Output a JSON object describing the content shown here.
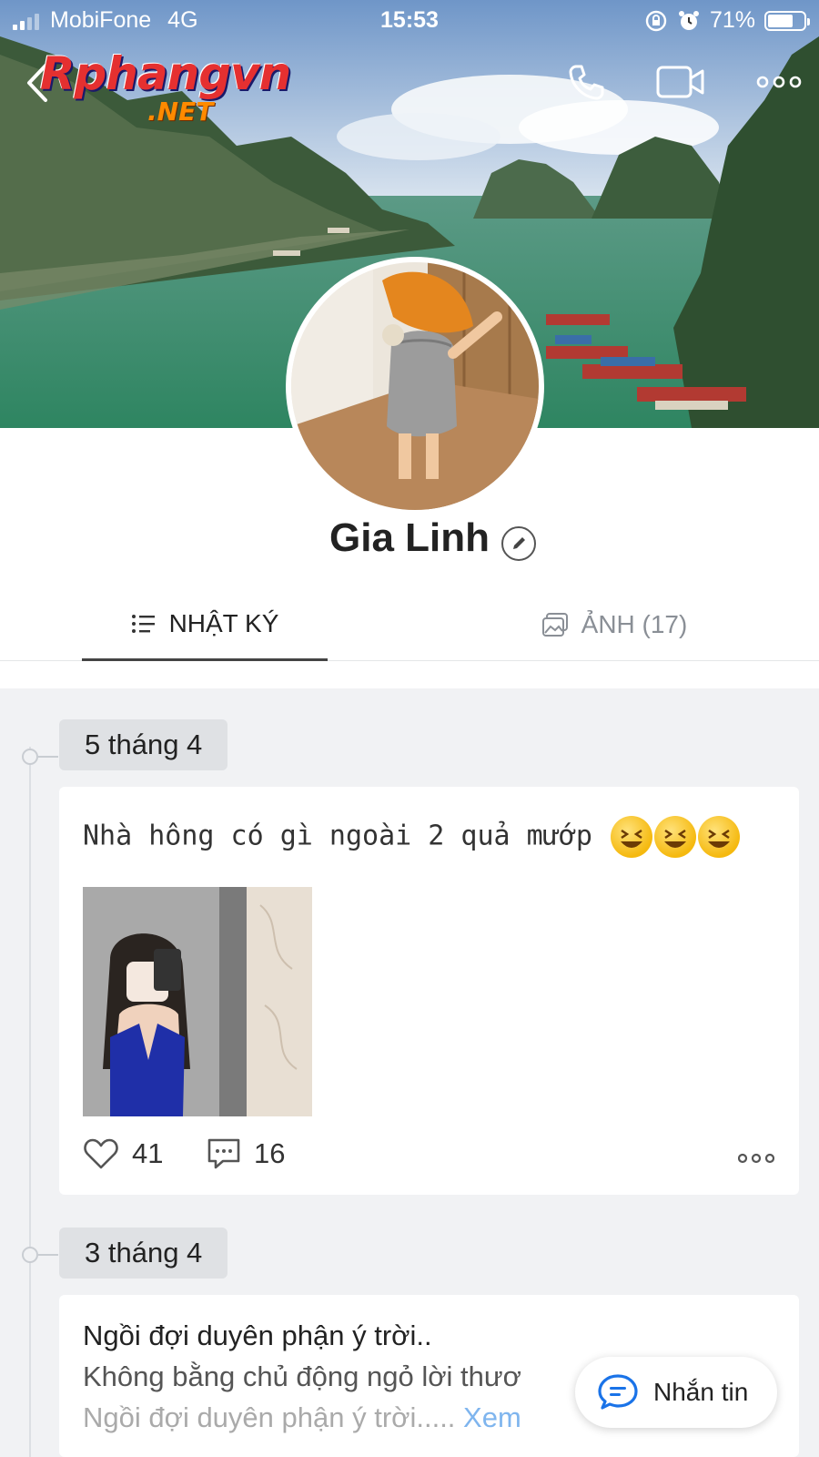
{
  "status_bar": {
    "carrier": "MobiFone",
    "network": "4G",
    "time": "15:53",
    "battery": "71%",
    "battery_level": 0.71,
    "signal_bars_active": 2,
    "signal_bars_total": 4
  },
  "watermark": {
    "main": "Rphangvn",
    "sub": ".NET"
  },
  "header": {
    "back_icon": "chevron-left-icon",
    "call_icon": "phone-icon",
    "video_icon": "video-camera-icon",
    "more_icon": "more-horizontal-icon"
  },
  "profile": {
    "name": "Gia Linh",
    "edit_icon": "pencil-icon"
  },
  "tabs": [
    {
      "label": "NHẬT KÝ",
      "icon": "list-icon",
      "active": true
    },
    {
      "label": "ẢNH (17)",
      "icon": "gallery-icon",
      "active": false
    }
  ],
  "feed": {
    "posts": [
      {
        "date": "5 tháng 4",
        "text": "Nhà hông có gì ngoài 2 quả mướp",
        "emoji_count": 3,
        "likes": "41",
        "comments": "16"
      },
      {
        "date": "3 tháng 4",
        "line1": "Ngồi đợi duyên phận ý trời..",
        "line2": "Không bằng chủ động ngỏ lời thươ",
        "line3": "Ngồi đợi duyên phận ý trời.....",
        "see_more": "Xem"
      }
    ]
  },
  "fab": {
    "label": "Nhắn tin",
    "icon": "chat-bubble-icon"
  },
  "colors": {
    "accent_blue": "#1a73e8",
    "link_blue": "#7fb5ee",
    "feed_bg": "#f1f2f4",
    "chip_bg": "#dfe1e4"
  }
}
